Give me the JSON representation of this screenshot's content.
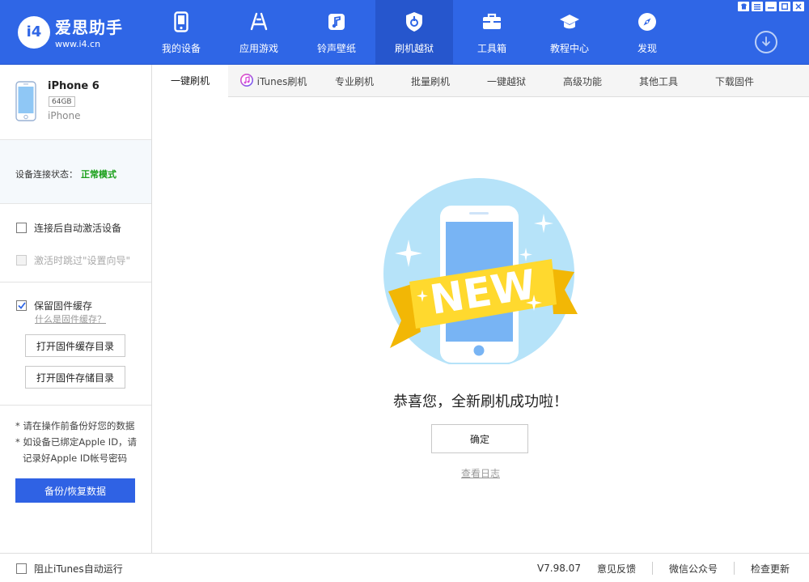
{
  "app": {
    "logo_badge": "i4",
    "name": "爱思助手",
    "url": "www.i4.cn",
    "brand_color": "#2f66e6"
  },
  "nav": {
    "items": [
      {
        "label": "我的设备",
        "icon": "phone-icon"
      },
      {
        "label": "应用游戏",
        "icon": "app-store-icon"
      },
      {
        "label": "铃声壁纸",
        "icon": "music-icon"
      },
      {
        "label": "刷机越狱",
        "icon": "flash-icon",
        "active": true
      },
      {
        "label": "工具箱",
        "icon": "toolbox-icon"
      },
      {
        "label": "教程中心",
        "icon": "graduation-cap-icon"
      },
      {
        "label": "发现",
        "icon": "compass-icon"
      }
    ]
  },
  "device": {
    "name": "iPhone 6",
    "capacity": "64GB",
    "type": "iPhone"
  },
  "connection": {
    "label": "设备连接状态：",
    "value": "正常模式",
    "value_color": "#1aa01a"
  },
  "options": {
    "auto_activate": "连接后自动激活设备",
    "skip_setup": "激活时跳过\"设置向导\"",
    "keep_cache": "保留固件缓存",
    "what_is_cache": "什么是固件缓存？"
  },
  "sidebar_buttons": {
    "open_cache_dir": "打开固件缓存目录",
    "open_storage_dir": "打开固件存储目录",
    "backup": "备份/恢复数据"
  },
  "notes": {
    "line1": "* 请在操作前备份好您的数据",
    "line2": "* 如设备已绑定Apple ID，请",
    "line3": "记录好Apple ID帐号密码"
  },
  "tabs": [
    {
      "label": "一键刷机",
      "active": true
    },
    {
      "label": "iTunes刷机",
      "icon": "itunes-icon"
    },
    {
      "label": "专业刷机"
    },
    {
      "label": "批量刷机"
    },
    {
      "label": "一键越狱"
    },
    {
      "label": "高级功能"
    },
    {
      "label": "其他工具"
    },
    {
      "label": "下载固件"
    }
  ],
  "main": {
    "badge_text": "NEW",
    "success_message": "恭喜您，全新刷机成功啦！",
    "confirm_label": "确定",
    "log_link": "查看日志"
  },
  "statusbar": {
    "stop_itunes": "阻止iTunes自动运行",
    "version": "V7.98.07",
    "feedback": "意见反馈",
    "wechat": "微信公众号",
    "check_update": "检查更新"
  }
}
